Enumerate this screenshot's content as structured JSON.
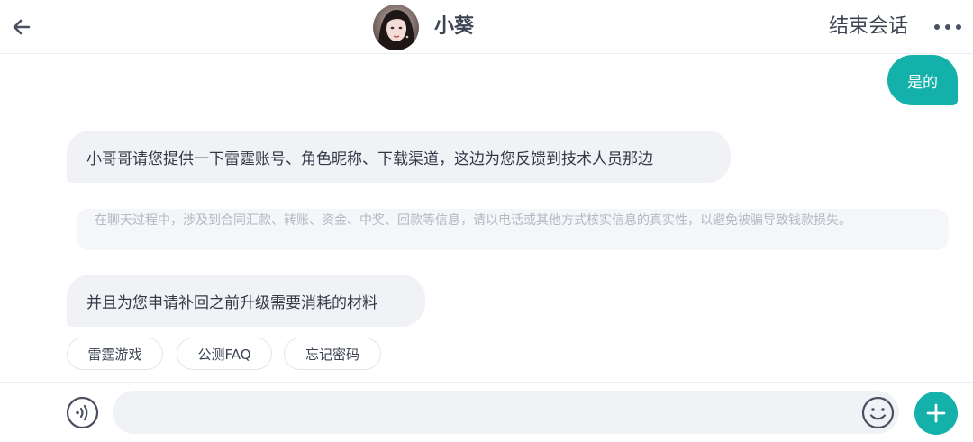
{
  "header": {
    "agent_name": "小葵",
    "end_label": "结束会话",
    "icons": {
      "back": "arrow-left-icon",
      "more": "more-horizontal-icon",
      "avatar": "agent-avatar"
    }
  },
  "messages": [
    {
      "from": "user",
      "text": "是的"
    },
    {
      "from": "agent",
      "text": "小哥哥请您提供一下雷霆账号、角色昵称、下载渠道，这边为您反馈到技术人员那边"
    },
    {
      "from": "agent",
      "text": "并且为您申请补回之前升级需要消耗的材料"
    }
  ],
  "notice": "在聊天过程中，涉及到合同汇款、转账、资金、中奖、回款等信息，请以电话或其他方式核实信息的真实性，以避免被骗导致钱款损失。",
  "quick_replies": [
    {
      "label": "雷霆游戏"
    },
    {
      "label": "公测FAQ"
    },
    {
      "label": "忘记密码"
    }
  ],
  "input": {
    "value": "",
    "placeholder": ""
  },
  "colors": {
    "accent": "#13b1a9",
    "bubble": "#f0f2f6",
    "text": "#3c4352",
    "notice_text": "#b4b8c1"
  },
  "footer_icons": {
    "voice": "voice-icon",
    "emoji": "emoji-icon",
    "add": "plus-icon"
  }
}
